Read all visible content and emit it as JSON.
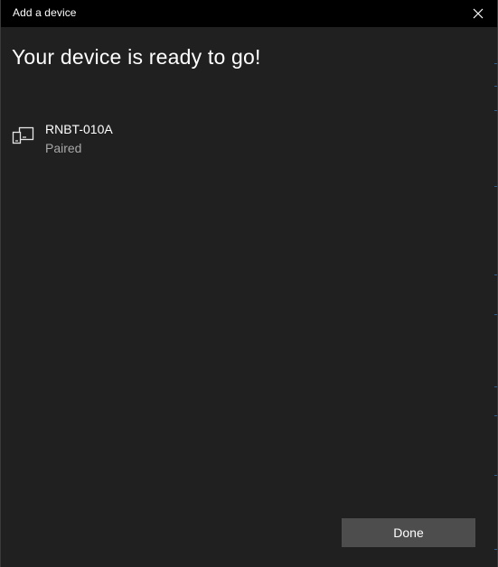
{
  "window": {
    "title": "Add a device"
  },
  "main": {
    "heading": "Your device is ready to go!",
    "device": {
      "name": "RNBT-010A",
      "status": "Paired",
      "icon": "input-device-icon"
    }
  },
  "footer": {
    "done_label": "Done"
  },
  "colors": {
    "background": "#202020",
    "titlebar": "#000000",
    "button": "#4d4d4d",
    "secondary_text": "#a8a8a8"
  }
}
